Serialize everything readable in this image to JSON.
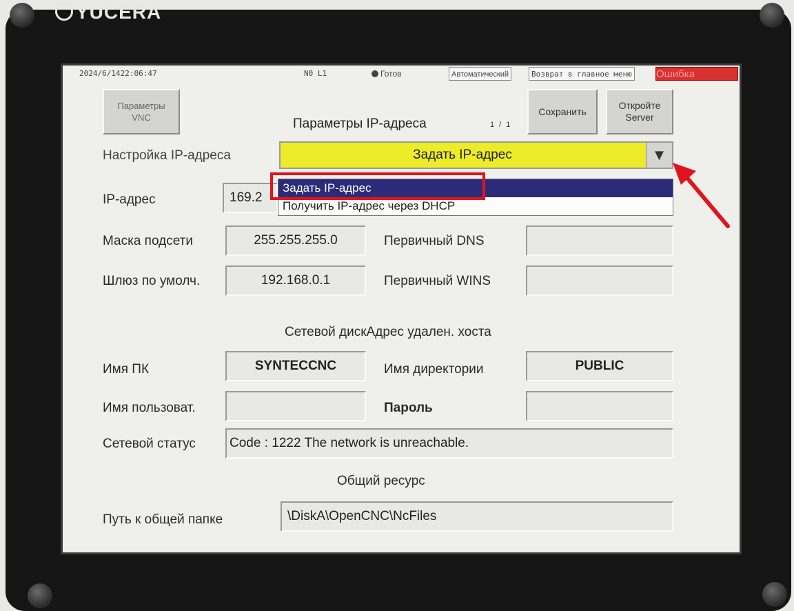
{
  "brand": "YUCERA",
  "status_bar": {
    "datetime": "2024/6/1422:06:47",
    "coord": "N0 L1",
    "state": "Готов",
    "mode": "Автоматический",
    "back_button": "Возврат в главное меню",
    "error": "Ошибка"
  },
  "header": {
    "vnc_button": "Параметры VNC",
    "title": "Параметры IP-адреса",
    "page": "1 / 1",
    "save_button": "Сохранить",
    "server_button_line1": "Откройте",
    "server_button_line2": "Server"
  },
  "ip_setting": {
    "label": "Настройка IP-адреса",
    "selected": "Задать IP-адрес",
    "options": [
      "Задать IP-адрес",
      "Получить IP-адрес через DHCP"
    ]
  },
  "network": {
    "ip_label": "IP-адрес",
    "ip_value": "169.2",
    "mask_label": "Маска подсети",
    "mask_value": "255.255.255.0",
    "gateway_label": "Шлюз по умолч.",
    "gateway_value": "192.168.0.1",
    "dns_label": "Первичный DNS",
    "dns_value": "",
    "wins_label": "Первичный WINS",
    "wins_value": ""
  },
  "remote": {
    "section_title": "Сетевой дискАдрес удален. хоста",
    "pc_label": "Имя ПК",
    "pc_value": "SYNTECCNC",
    "dir_label": "Имя директории",
    "dir_value": "PUBLIC",
    "user_label": "Имя пользоват.",
    "user_value": "",
    "password_label": "Пароль",
    "password_value": "",
    "status_label": "Сетевой статус",
    "status_value": "Code : 1222 The network is unreachable."
  },
  "share": {
    "section_title": "Общий ресурс",
    "path_label": "Путь к общей папке",
    "path_value": "\\DiskA\\OpenCNC\\NcFiles"
  },
  "colors": {
    "combo_yellow": "#ecec28",
    "selected_option": "#2b2b7a",
    "error_red": "#d93030",
    "annotation_red": "#e0141c"
  }
}
